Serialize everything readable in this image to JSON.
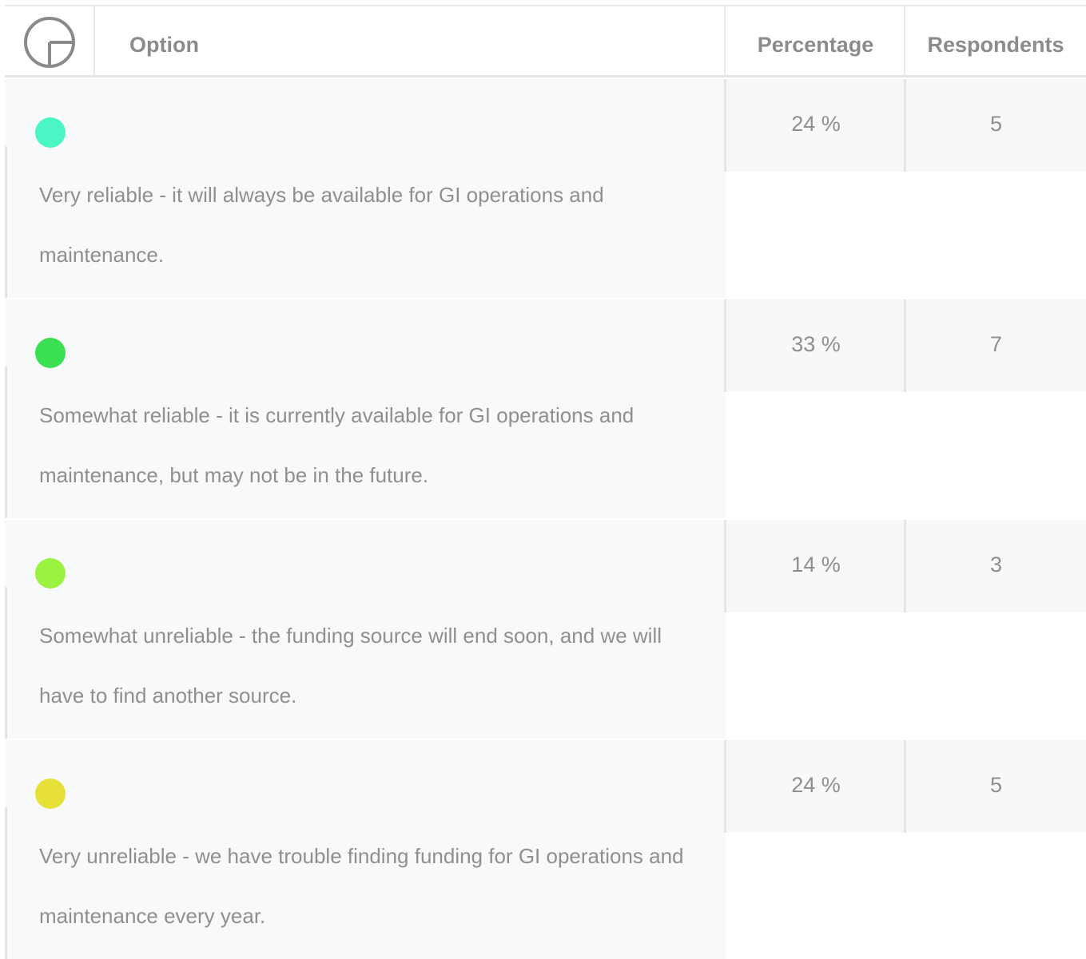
{
  "header": {
    "option_label": "Option",
    "percentage_label": "Percentage",
    "respondents_label": "Respondents",
    "icon": "pie-chart-icon"
  },
  "rows": [
    {
      "color": "#4cf5c4",
      "option": "Very reliable - it will always be available for GI operations and maintenance.",
      "percentage": "24 %",
      "respondents": "5"
    },
    {
      "color": "#3ae052",
      "option": "Somewhat reliable - it is currently available for GI operations and maintenance, but may not be in the future.",
      "percentage": "33 %",
      "respondents": "7"
    },
    {
      "color": "#9bf240",
      "option": "Somewhat unreliable - the funding source will end soon, and we will have to find another source.",
      "percentage": "14 %",
      "respondents": "3"
    },
    {
      "color": "#e6e038",
      "option": "Very unreliable - we have trouble finding funding for GI operations and maintenance every year.",
      "percentage": "24 %",
      "respondents": "5"
    }
  ]
}
